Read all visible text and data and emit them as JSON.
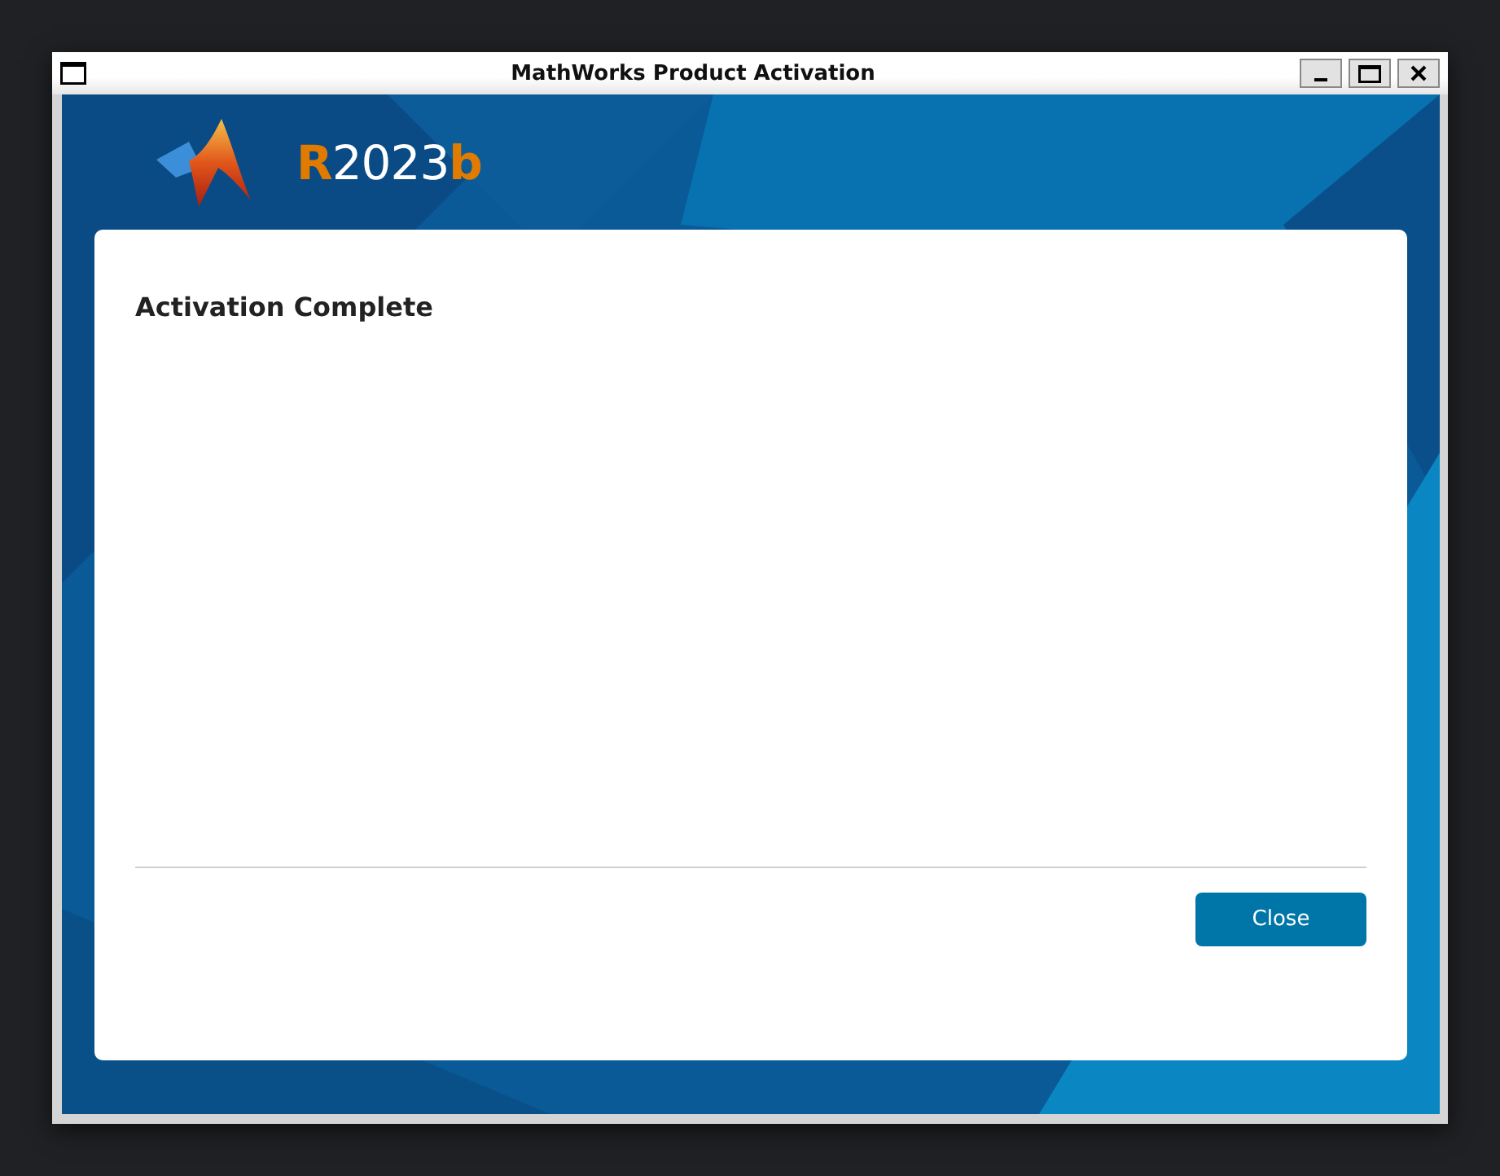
{
  "window": {
    "title": "MathWorks Product Activation"
  },
  "banner": {
    "release_prefix": "R",
    "release_year": "2023",
    "release_suffix": "b"
  },
  "dialog": {
    "heading": "Activation Complete",
    "buttons": [
      "Close"
    ]
  }
}
